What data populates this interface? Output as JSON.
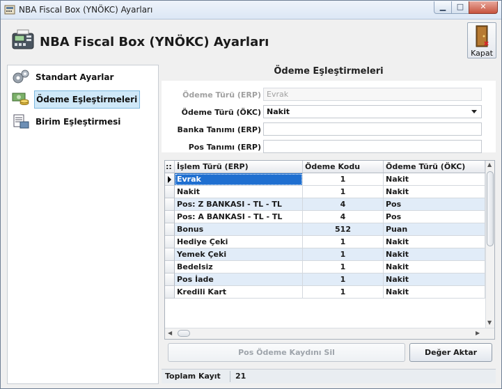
{
  "window": {
    "title": "NBA Fiscal Box (YNÖKC) Ayarları",
    "controls": {
      "minimize": "▁",
      "maximize": "□",
      "close": "✕"
    }
  },
  "header": {
    "title": "NBA Fiscal Box (YNÖKC) Ayarları",
    "icon": "pos-terminal-icon",
    "close_button_label": "Kapat",
    "close_button_icon": "door-exit-icon"
  },
  "sidebar": {
    "items": [
      {
        "label": "Standart Ayarlar",
        "icon": "gears-icon",
        "selected": false
      },
      {
        "label": "Ödeme Eşleştirmeleri",
        "icon": "payment-mapping-icon",
        "selected": true
      },
      {
        "label": "Birim Eşleştirmesi",
        "icon": "unit-mapping-icon",
        "selected": false
      }
    ]
  },
  "main": {
    "section_title": "Ödeme Eşleştirmeleri",
    "form": {
      "odeme_turu_erp": {
        "label": "Ödeme Türü (ERP)",
        "value": "Evrak",
        "disabled": true
      },
      "odeme_turu_okc": {
        "label": "Ödeme Türü (ÖKC)",
        "value": "Nakit"
      },
      "banka_tanimi": {
        "label": "Banka Tanımı (ERP)",
        "value": ""
      },
      "pos_tanimi": {
        "label": "Pos Tanımı (ERP)",
        "value": ""
      }
    },
    "grid": {
      "corner": "::",
      "columns": [
        "İşlem Türü (ERP)",
        "Ödeme Kodu (ÖKC)",
        "Ödeme Türü (ÖKC)"
      ],
      "rows": [
        [
          "Evrak",
          "1",
          "Nakit"
        ],
        [
          "Nakit",
          "1",
          "Nakit"
        ],
        [
          "Pos: Z BANKASI - TL - TL",
          "4",
          "Pos"
        ],
        [
          "Pos: A BANKASI - TL - TL",
          "4",
          "Pos"
        ],
        [
          "Bonus",
          "512",
          "Puan"
        ],
        [
          "Hediye Çeki",
          "1",
          "Nakit"
        ],
        [
          "Yemek Çeki",
          "1",
          "Nakit"
        ],
        [
          "Bedelsiz",
          "1",
          "Nakit"
        ],
        [
          "Pos İade",
          "1",
          "Nakit"
        ],
        [
          "Kredili Kart",
          "1",
          "Nakit"
        ]
      ],
      "active_row": 0
    },
    "buttons": {
      "delete_pos": "Pos Ödeme Kaydını Sil",
      "transfer": "Değer Aktar"
    },
    "status": {
      "label": "Toplam Kayıt",
      "value": "21"
    }
  },
  "colors": {
    "selection": "#1f6fd0",
    "alt_row": "#e1ecf8",
    "nav_selected": "#cfe8f8"
  }
}
